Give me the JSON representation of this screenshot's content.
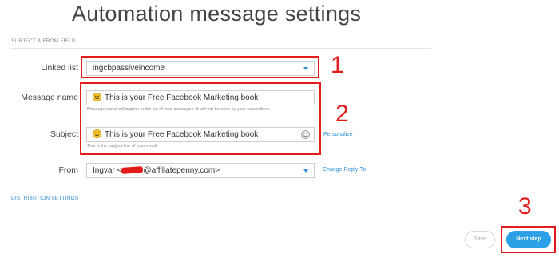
{
  "page": {
    "title": "Automation message settings"
  },
  "section_subject_from": {
    "label": "SUBJECT & FROM FIELD"
  },
  "linked_list": {
    "label": "Linked list",
    "value": "ingcbpassiveincome"
  },
  "message_name": {
    "label": "Message name",
    "value": "This is your Free Facebook Marketing book",
    "helper": "Message name will appear in the list of your messages. It will not be seen by your subscribers."
  },
  "subject": {
    "label": "Subject",
    "value": "This is your Free Facebook Marketing book",
    "helper": "This is the subject line of your email.",
    "personalize_link": "Personalize"
  },
  "from": {
    "label": "From",
    "value_prefix": "Ingvar <",
    "value_suffix": "@affiliatepenny.com>",
    "change_reply_link": "Change Reply-To"
  },
  "section_distribution": {
    "label": "DISTRIBUTION SETTINGS"
  },
  "footer": {
    "save_label": "Save",
    "next_label": "Next step"
  },
  "annotations": {
    "n1": "1",
    "n2": "2",
    "n3": "3"
  },
  "colors": {
    "accent": "#2aa1e6",
    "link": "#2f8fd6",
    "annotation_red": "#e31b1b"
  },
  "icons": {
    "smiley": "smiley-emoji-icon",
    "emoji_picker": "emoji-picker-icon",
    "dropdown": "chevron-down-icon"
  }
}
